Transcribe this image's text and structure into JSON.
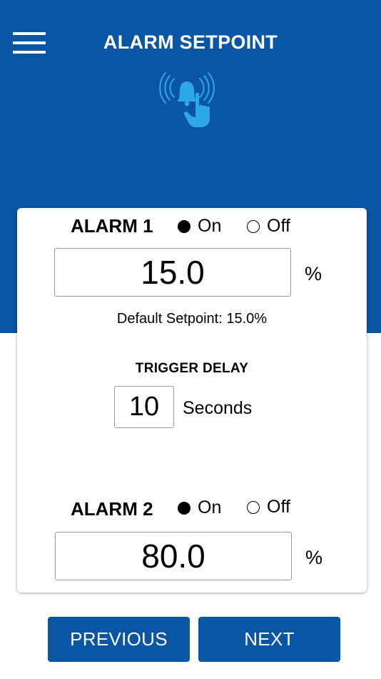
{
  "header": {
    "title": "ALARM SETPOINT",
    "menu_icon": "hamburger-menu-icon",
    "hero_icon": "bell-touch-icon",
    "background_color": "#0a56a4",
    "icon_color": "#2ea7e6"
  },
  "alarm1": {
    "label": "ALARM 1",
    "on_label": "On",
    "off_label": "Off",
    "selected": "On",
    "value": "15.0",
    "unit": "%",
    "default_text": "Default Setpoint: 15.0%"
  },
  "trigger_delay": {
    "title": "TRIGGER DELAY",
    "value": "10",
    "unit": "Seconds"
  },
  "alarm2": {
    "label": "ALARM 2",
    "on_label": "On",
    "off_label": "Off",
    "selected": "On",
    "value": "80.0",
    "unit": "%"
  },
  "footer": {
    "previous_label": "PREVIOUS",
    "next_label": "NEXT"
  }
}
